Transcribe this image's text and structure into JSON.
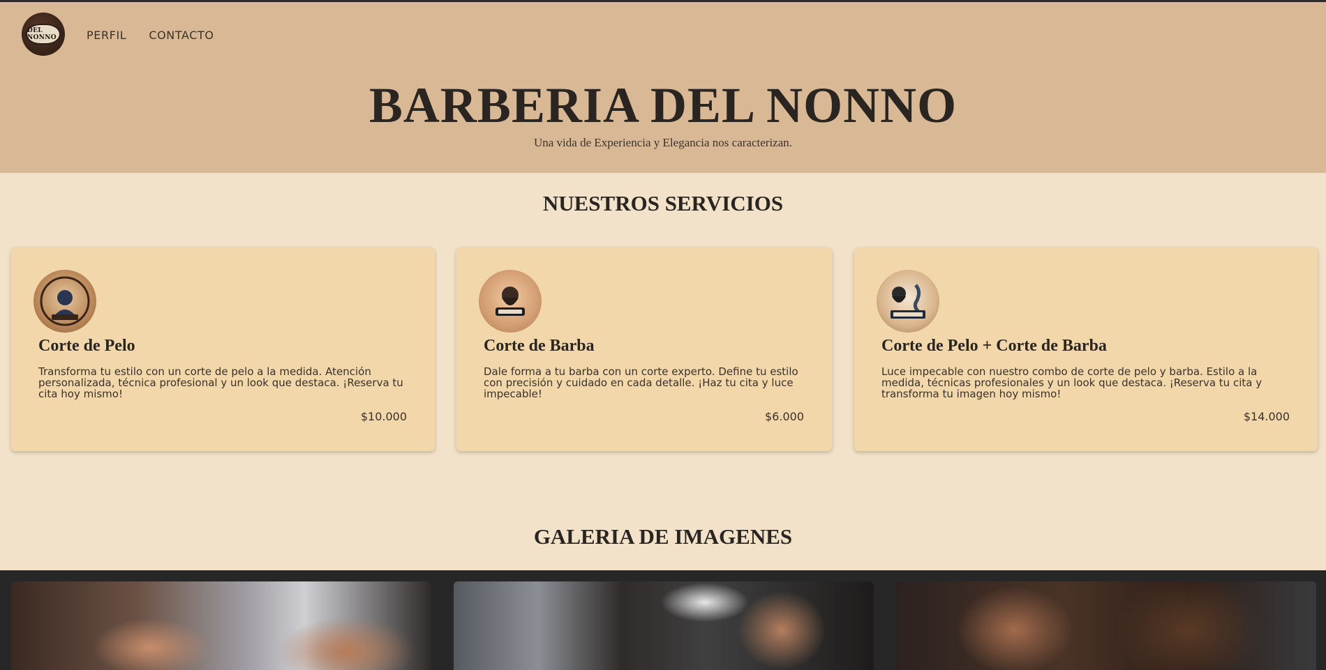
{
  "header": {
    "logo_text": "DEL NONNO",
    "nav": [
      {
        "label": "PERFIL"
      },
      {
        "label": "CONTACTO"
      }
    ],
    "title": "BARBERIA DEL NONNO",
    "subtitle": "Una vida de Experiencia y Elegancia nos caracterizan."
  },
  "services": {
    "title": "NUESTROS SERVICIOS",
    "items": [
      {
        "icon": "barber-logo-icon",
        "title": "Corte de Pelo",
        "description": "Transforma tu estilo con un corte de pelo a la medida. Atención personalizada, técnica profesional y un look que destaca. ¡Reserva tu cita hoy mismo!",
        "price": "$10.000"
      },
      {
        "icon": "bearded-man-logo-icon",
        "title": "Corte de Barba",
        "description": "Dale forma a tu barba con un corte experto. Define tu estilo con precisión y cuidado en cada detalle. ¡Haz tu cita y luce impecable!",
        "price": "$6.000"
      },
      {
        "icon": "barber-combo-logo-icon",
        "title": "Corte de Pelo + Corte de Barba",
        "description": "Luce impecable con nuestro combo de corte de pelo y barba. Estilo a la medida, técnicas profesionales y un look que destaca. ¡Reserva tu cita y transforma tu imagen hoy mismo!",
        "price": "$14.000"
      }
    ]
  },
  "gallery": {
    "title": "GALERIA DE IMAGENES"
  }
}
